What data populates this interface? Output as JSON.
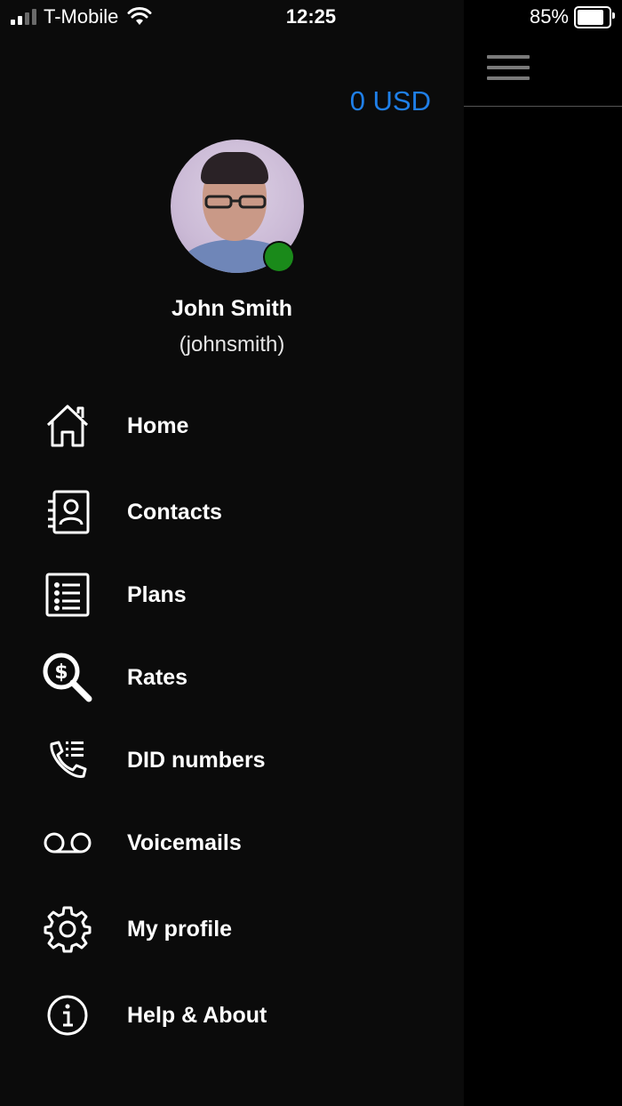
{
  "status_bar": {
    "carrier": "T-Mobile",
    "time": "12:25",
    "battery": "85%",
    "battery_level": 0.85,
    "signal_bars": 2
  },
  "drawer": {
    "balance": "0 USD",
    "user": {
      "name": "John Smith",
      "username": "(johnsmith)",
      "status": "online"
    },
    "menu": [
      {
        "label": "Home",
        "icon": "home-icon"
      },
      {
        "label": "Contacts",
        "icon": "contacts-icon"
      },
      {
        "label": "Plans",
        "icon": "plans-list-icon"
      },
      {
        "label": "Rates",
        "icon": "rates-search-dollar-icon"
      },
      {
        "label": "DID numbers",
        "icon": "phone-list-icon"
      },
      {
        "label": "Voicemails",
        "icon": "voicemail-icon"
      },
      {
        "label": "My profile",
        "icon": "gear-icon"
      },
      {
        "label": "Help & About",
        "icon": "info-icon"
      }
    ]
  },
  "colors": {
    "accent": "#1f7fe8",
    "online": "#1a8a1a",
    "drawer_bg": "#0b0b0b"
  }
}
